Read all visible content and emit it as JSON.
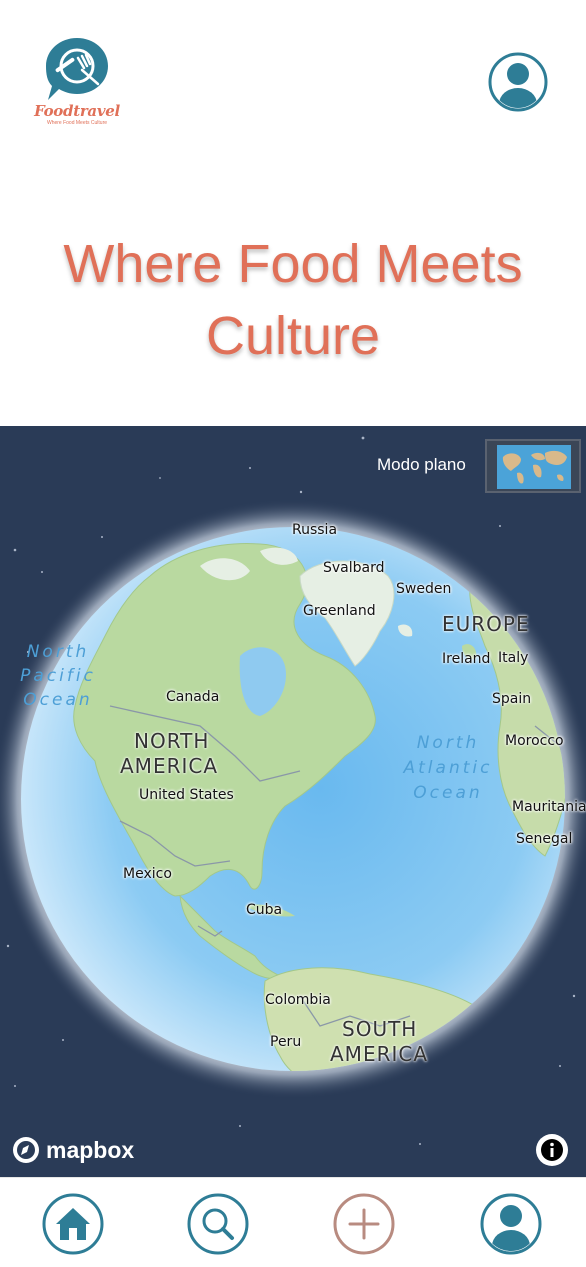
{
  "header": {
    "logo": {
      "name": "Foodtravel",
      "tagline": "Where Food Meets Culture"
    },
    "hero_title": "Where Food Meets Culture"
  },
  "map": {
    "view_toggle_label": "Modo plano",
    "attribution": "mapbox",
    "labels": {
      "russia": "Russia",
      "svalbard": "Svalbard",
      "sweden": "Sweden",
      "greenland": "Greenland",
      "europe": "EUROPE",
      "ireland": "Ireland",
      "italy": "Italy",
      "spain": "Spain",
      "morocco": "Morocco",
      "mauritania": "Mauritania",
      "senegal": "Senegal",
      "canada": "Canada",
      "north_america_1": "NORTH",
      "north_america_2": "AMERICA",
      "united_states": "United States",
      "mexico": "Mexico",
      "cuba": "Cuba",
      "colombia": "Colombia",
      "peru": "Peru",
      "south_america_1": "SOUTH",
      "south_america_2": "AMERICA",
      "north_pacific_1": "North",
      "north_pacific_2": "Pacific",
      "north_pacific_3": "Ocean",
      "north_atlantic_1": "North",
      "north_atlantic_2": "Atlantic",
      "north_atlantic_3": "Ocean"
    }
  },
  "navbar": {
    "items": [
      {
        "icon": "home-icon"
      },
      {
        "icon": "search-icon"
      },
      {
        "icon": "plus-icon"
      },
      {
        "icon": "profile-icon"
      }
    ]
  },
  "colors": {
    "brand": "#e07058",
    "teal": "#2e7d96",
    "add_button": "#b88b80",
    "map_space": "#2a3b57"
  }
}
